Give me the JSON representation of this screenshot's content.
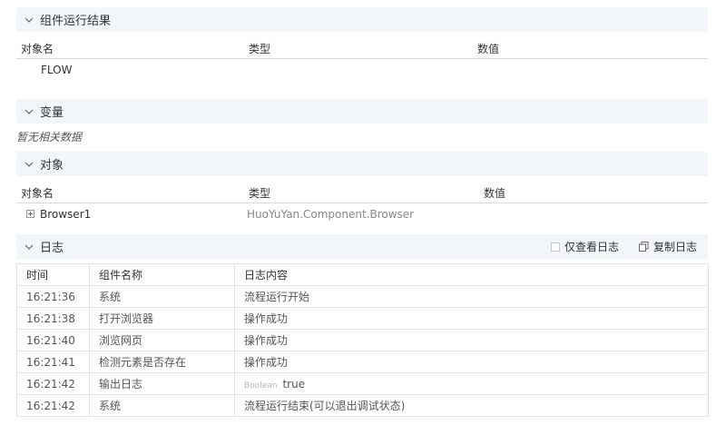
{
  "component_result": {
    "title": "组件运行结果",
    "columns": [
      "对象名",
      "类型",
      "数值"
    ],
    "rows": [
      {
        "name": "FLOW",
        "type": "",
        "value": ""
      }
    ]
  },
  "variables": {
    "title": "变量",
    "empty_text": "暂无相关数据"
  },
  "objects": {
    "title": "对象",
    "columns": [
      "对象名",
      "类型",
      "数值"
    ],
    "rows": [
      {
        "name": "Browser1",
        "type": "HuoYuYan.Component.Browser",
        "value": ""
      }
    ]
  },
  "log": {
    "title": "日志",
    "only_log_label": "仅查看日志",
    "copy_log_label": "复制日志",
    "columns": [
      "时间",
      "组件名称",
      "日志内容"
    ],
    "rows": [
      {
        "time": "16:21:36",
        "component": "系统",
        "content": "流程运行开始",
        "tag": ""
      },
      {
        "time": "16:21:38",
        "component": "打开浏览器",
        "content": "操作成功",
        "tag": ""
      },
      {
        "time": "16:21:40",
        "component": "浏览网页",
        "content": "操作成功",
        "tag": ""
      },
      {
        "time": "16:21:41",
        "component": "检测元素是否存在",
        "content": "操作成功",
        "tag": ""
      },
      {
        "time": "16:21:42",
        "component": "输出日志",
        "content": "true",
        "tag": "Boolean"
      },
      {
        "time": "16:21:42",
        "component": "系统",
        "content": "流程运行结束(可以退出调试状态)",
        "tag": ""
      }
    ]
  },
  "icons": {
    "collapse": "chevron-down-icon",
    "copy": "copy-icon",
    "expand": "plus-box-icon"
  }
}
